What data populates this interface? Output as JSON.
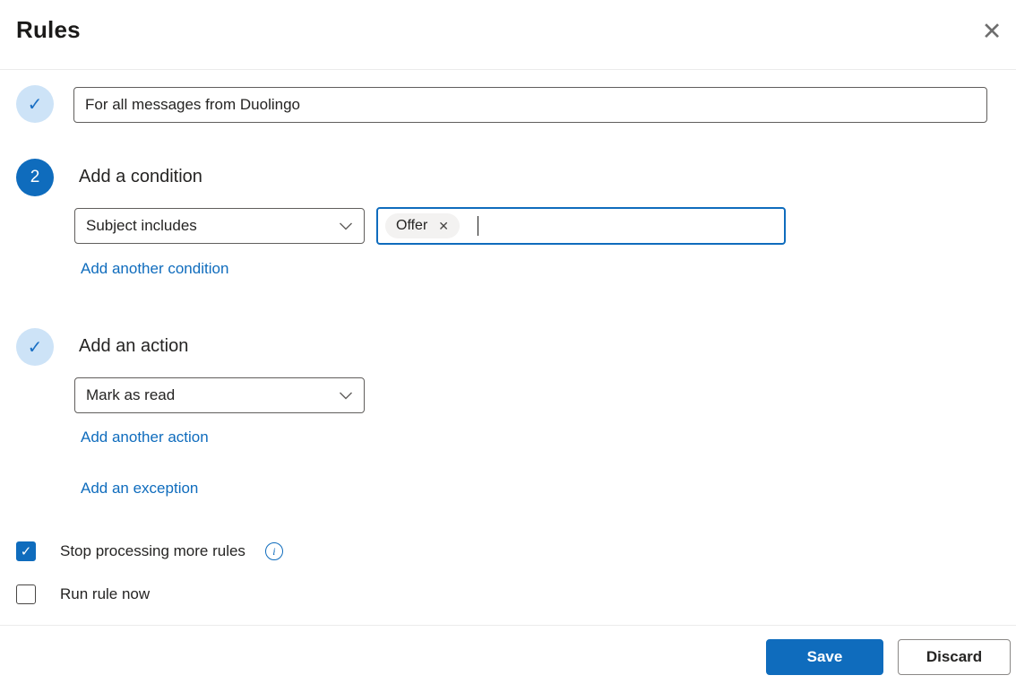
{
  "dialog": {
    "title": "Rules",
    "close_icon": "✕"
  },
  "step1": {
    "status_icon": "✓",
    "rule_name_value": "For all messages from Duolingo"
  },
  "step2": {
    "number": "2",
    "heading": "Add a condition",
    "condition_selected": "Subject includes",
    "condition_value_chip": {
      "label": "Offer",
      "remove_icon": "✕"
    },
    "add_another_link": "Add another condition"
  },
  "step3": {
    "status_icon": "✓",
    "heading": "Add an action",
    "action_selected": "Mark as read",
    "add_another_link": "Add another action",
    "add_exception_link": "Add an exception"
  },
  "options": {
    "stop_processing": {
      "label": "Stop processing more rules",
      "checked": true,
      "check_icon": "✓",
      "info_icon": "i"
    },
    "run_rule_now": {
      "label": "Run rule now",
      "checked": false
    }
  },
  "footer": {
    "save_label": "Save",
    "discard_label": "Discard"
  },
  "colors": {
    "accent_blue": "#0f6cbd",
    "step_done_bg": "#cde3f7",
    "link_blue": "#0f6cbd",
    "input_border": "#605e5c",
    "focused_border": "#0f6cbd",
    "chip_bg": "#f3f2f1",
    "divider": "#ebebeb"
  }
}
